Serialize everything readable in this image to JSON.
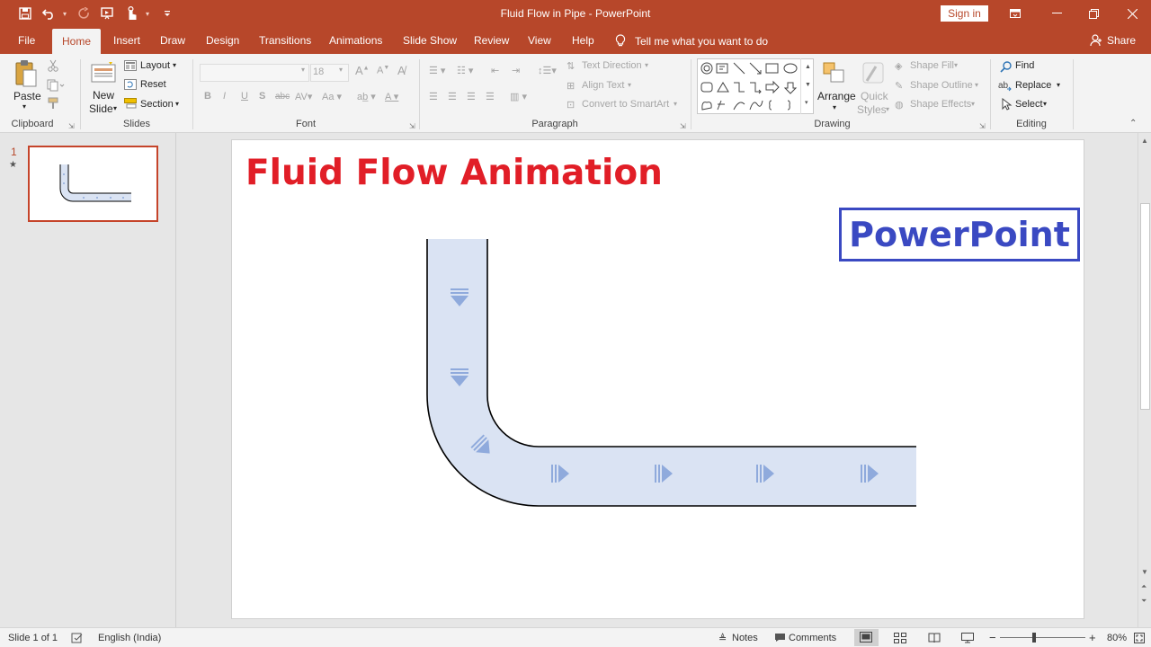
{
  "app": {
    "title": "Fluid Flow in Pipe  -  PowerPoint",
    "sign_in": "Sign in",
    "share": "Share",
    "tell_me": "Tell me what you want to do",
    "accent": "#b7472a"
  },
  "tabs": [
    "File",
    "Home",
    "Insert",
    "Draw",
    "Design",
    "Transitions",
    "Animations",
    "Slide Show",
    "Review",
    "View",
    "Help"
  ],
  "ribbon": {
    "clipboard": {
      "label": "Clipboard",
      "paste": "Paste"
    },
    "slides": {
      "label": "Slides",
      "new_slide_1": "New",
      "new_slide_2": "Slide",
      "layout": "Layout",
      "reset": "Reset",
      "section": "Section"
    },
    "font": {
      "label": "Font",
      "size": "18"
    },
    "paragraph": {
      "label": "Paragraph",
      "text_direction": "Text Direction",
      "align_text": "Align Text",
      "convert_smartart": "Convert to SmartArt"
    },
    "drawing": {
      "label": "Drawing",
      "arrange": "Arrange",
      "quick_styles_1": "Quick",
      "quick_styles_2": "Styles",
      "shape_fill": "Shape Fill",
      "shape_outline": "Shape Outline",
      "shape_effects": "Shape Effects"
    },
    "editing": {
      "label": "Editing",
      "find": "Find",
      "replace": "Replace",
      "select": "Select"
    }
  },
  "thumbs": {
    "number": "1",
    "star": "★"
  },
  "slide": {
    "title": "Fluid Flow Animation",
    "title_color": "#e11e27",
    "badge": "PowerPoint",
    "badge_color": "#3a49c2",
    "pipe_fill": "#dae3f3",
    "arrow_color": "#8faadc"
  },
  "status": {
    "slide_info": "Slide 1 of 1",
    "language": "English (India)",
    "notes": "Notes",
    "comments": "Comments",
    "zoom_minus": "−",
    "zoom_plus": "+",
    "zoom": "80%"
  }
}
